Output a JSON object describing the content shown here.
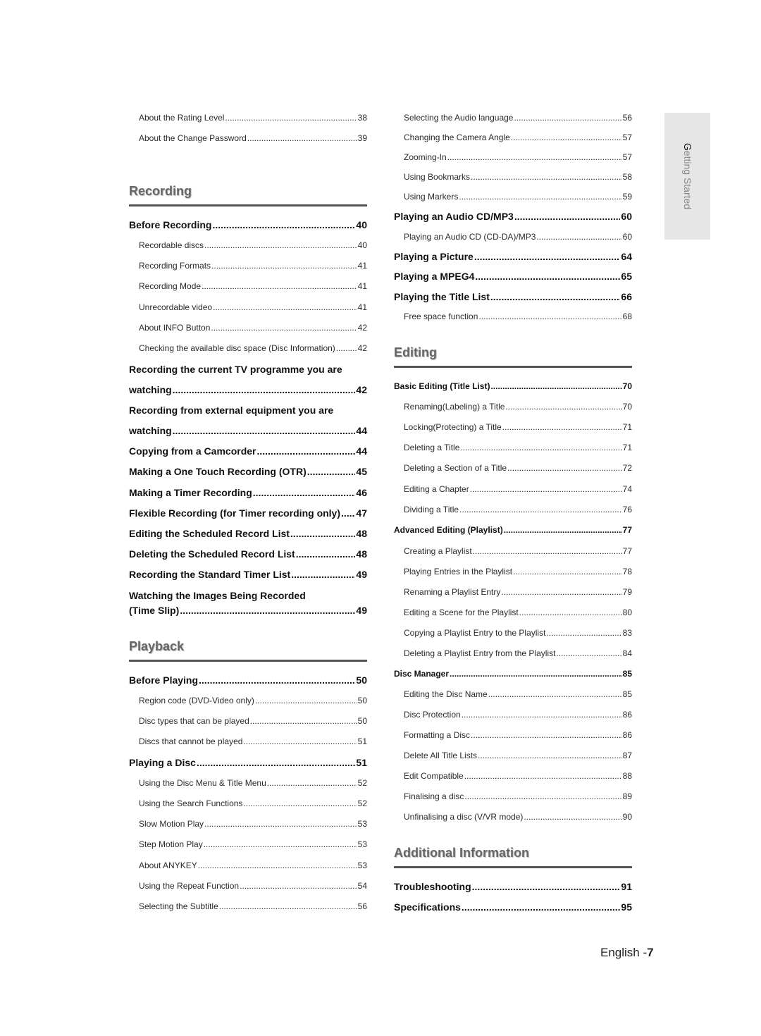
{
  "side_tab": {
    "label": "Getting Started"
  },
  "footer": {
    "language": "English -",
    "page_number": "7"
  },
  "left_column": {
    "top_entries": [
      {
        "label": "About the Rating Level",
        "page": "38",
        "level": "sub"
      },
      {
        "label": "About the Change Password",
        "page": "39",
        "level": "sub"
      }
    ],
    "sections": [
      {
        "title": "Recording",
        "entries": [
          {
            "label": "Before Recording",
            "page": "40",
            "level": "main"
          },
          {
            "label": "Recordable discs",
            "page": "40",
            "level": "sub"
          },
          {
            "label": "Recording Formats",
            "page": "41",
            "level": "sub"
          },
          {
            "label": "Recording Mode",
            "page": "41",
            "level": "sub"
          },
          {
            "label": "Unrecordable video",
            "page": "41",
            "level": "sub"
          },
          {
            "label": "About INFO Button",
            "page": "42",
            "level": "sub"
          },
          {
            "label": "Checking the available disc space (Disc Information)",
            "page": "42",
            "level": "sub"
          },
          {
            "label_line1": "Recording the current TV programme you are",
            "label": "watching",
            "page": "42",
            "level": "main"
          },
          {
            "label_line1": "Recording from external equipment you are",
            "label": "watching",
            "page": "44",
            "level": "main"
          },
          {
            "label": "Copying from a Camcorder",
            "page": "44",
            "level": "main"
          },
          {
            "label": "Making a One Touch Recording (OTR)",
            "page": "45",
            "level": "main"
          },
          {
            "label": "Making a Timer Recording",
            "page": "46",
            "level": "main"
          },
          {
            "label": "Flexible Recording (for Timer recording only)",
            "page": "47",
            "level": "main"
          },
          {
            "label": "Editing the Scheduled Record List",
            "page": "48",
            "level": "main"
          },
          {
            "label": "Deleting the Scheduled Record List",
            "page": "48",
            "level": "main"
          },
          {
            "label": "Recording the Standard Timer List",
            "page": "49",
            "level": "main"
          },
          {
            "label_line1": "Watching the Images Being Recorded",
            "label": "(Time Slip)",
            "page": "49",
            "level": "main"
          }
        ]
      },
      {
        "title": "Playback",
        "entries": [
          {
            "label": "Before Playing",
            "page": "50",
            "level": "main"
          },
          {
            "label": "Region code (DVD-Video only)",
            "page": "50",
            "level": "sub"
          },
          {
            "label": "Disc types that can be played",
            "page": "50",
            "level": "sub"
          },
          {
            "label": "Discs that cannot be played",
            "page": "51",
            "level": "sub"
          },
          {
            "label": "Playing a Disc",
            "page": "51",
            "level": "main"
          },
          {
            "label": "Using the Disc Menu & Title Menu",
            "page": "52",
            "level": "sub"
          },
          {
            "label": "Using the Search Functions",
            "page": "52",
            "level": "sub"
          },
          {
            "label": "Slow Motion Play",
            "page": "53",
            "level": "sub"
          },
          {
            "label": "Step Motion Play",
            "page": "53",
            "level": "sub"
          },
          {
            "label": "About ANYKEY",
            "page": "53",
            "level": "sub"
          },
          {
            "label": "Using the Repeat Function",
            "page": "54",
            "level": "sub"
          },
          {
            "label": "Selecting the Subtitle",
            "page": "56",
            "level": "sub"
          }
        ]
      }
    ]
  },
  "right_column": {
    "top_entries": [
      {
        "label": "Selecting the Audio language",
        "page": "56",
        "level": "sub"
      },
      {
        "label": "Changing the Camera Angle",
        "page": "57",
        "level": "sub"
      },
      {
        "label": "Zooming-In",
        "page": "57",
        "level": "sub"
      },
      {
        "label": "Using Bookmarks",
        "page": "58",
        "level": "sub"
      },
      {
        "label": "Using Markers",
        "page": "59",
        "level": "sub"
      },
      {
        "label": "Playing an Audio CD/MP3",
        "page": "60",
        "level": "main"
      },
      {
        "label": "Playing an Audio CD (CD-DA)/MP3",
        "page": "60",
        "level": "sub"
      },
      {
        "label": "Playing a Picture",
        "page": "64",
        "level": "main"
      },
      {
        "label": "Playing a MPEG4",
        "page": "65",
        "level": "main"
      },
      {
        "label": "Playing the Title List",
        "page": "66",
        "level": "main"
      },
      {
        "label": "Free space function",
        "page": "68",
        "level": "sub"
      }
    ],
    "sections": [
      {
        "title": "Editing",
        "entries": [
          {
            "label": "Basic Editing (Title List)",
            "page": "70",
            "level": "small-main"
          },
          {
            "label": "Renaming(Labeling) a Title",
            "page": "70",
            "level": "sub"
          },
          {
            "label": "Locking(Protecting) a Title",
            "page": "71",
            "level": "sub"
          },
          {
            "label": "Deleting a Title",
            "page": "71",
            "level": "sub"
          },
          {
            "label": "Deleting a Section of a Title",
            "page": "72",
            "level": "sub"
          },
          {
            "label": "Editing a Chapter",
            "page": "74",
            "level": "sub"
          },
          {
            "label": "Dividing a Title",
            "page": "76",
            "level": "sub"
          },
          {
            "label": "Advanced Editing (Playlist)",
            "page": "77",
            "level": "small-main"
          },
          {
            "label": "Creating a Playlist",
            "page": "77",
            "level": "sub"
          },
          {
            "label": "Playing Entries in the Playlist",
            "page": "78",
            "level": "sub"
          },
          {
            "label": "Renaming a Playlist Entry",
            "page": "79",
            "level": "sub"
          },
          {
            "label": "Editing a Scene for the Playlist",
            "page": "80",
            "level": "sub"
          },
          {
            "label": "Copying a Playlist Entry to the Playlist",
            "page": "83",
            "level": "sub"
          },
          {
            "label": "Deleting a Playlist Entry from the Playlist",
            "page": "84",
            "level": "sub"
          },
          {
            "label": "Disc Manager",
            "page": "85",
            "level": "small-main"
          },
          {
            "label": "Editing the Disc Name",
            "page": "85",
            "level": "sub"
          },
          {
            "label": "Disc Protection",
            "page": "86",
            "level": "sub"
          },
          {
            "label": "Formatting a Disc",
            "page": "86",
            "level": "sub"
          },
          {
            "label": "Delete All Title Lists",
            "page": "87",
            "level": "sub"
          },
          {
            "label": "Edit Compatible",
            "page": "88",
            "level": "sub"
          },
          {
            "label": "Finalising a disc",
            "page": "89",
            "level": "sub"
          },
          {
            "label": "Unfinalising a disc (V/VR mode)",
            "page": "90",
            "level": "sub"
          }
        ]
      },
      {
        "title": "Additional Information",
        "entries": [
          {
            "label": "Troubleshooting",
            "page": "91",
            "level": "main"
          },
          {
            "label": "Specifications",
            "page": "95",
            "level": "main"
          }
        ]
      }
    ]
  }
}
